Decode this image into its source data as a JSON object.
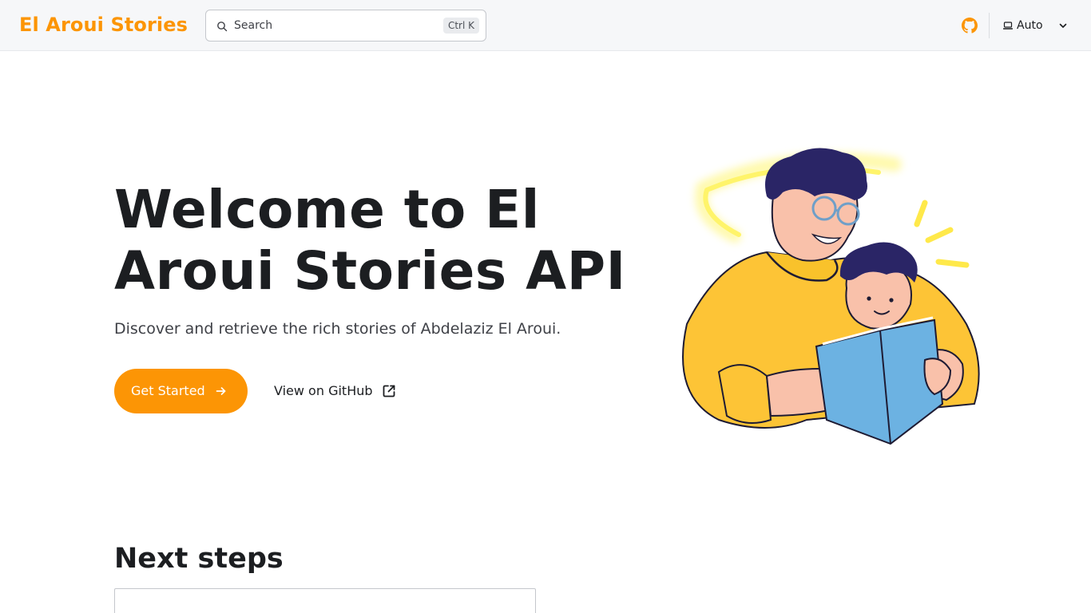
{
  "navbar": {
    "title": "El Aroui Stories",
    "search": {
      "placeholder": "Search",
      "shortcut": "Ctrl K"
    },
    "theme": {
      "label": "Auto"
    }
  },
  "hero": {
    "title": "Welcome to El Aroui Stories API",
    "subtitle": "Discover and retrieve the rich stories of Abdelaziz El Aroui.",
    "primary_button": "Get Started",
    "secondary_button": "View on GitHub"
  },
  "next_steps": {
    "title": "Next steps"
  },
  "colors": {
    "accent": "#fc9505",
    "text": "#1c1e21",
    "muted": "#3f4147",
    "nav_bg": "#f6f7f9"
  },
  "icons": [
    "search-icon",
    "github-icon",
    "laptop-icon",
    "chevron-down-icon",
    "arrow-right-icon",
    "external-link-icon"
  ]
}
